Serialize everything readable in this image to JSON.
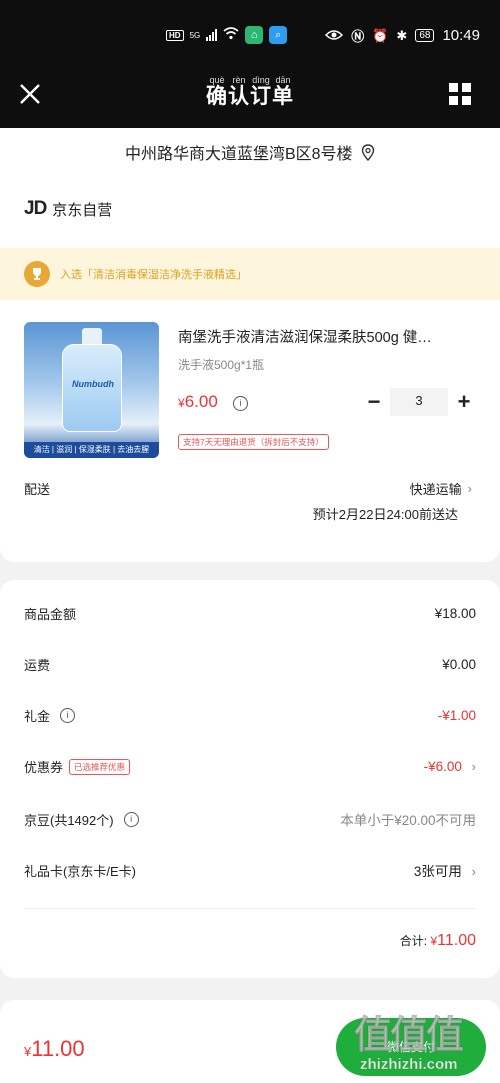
{
  "status_bar": {
    "network_label": "HD",
    "signal_label": "5G",
    "battery": "68",
    "time": "10:49"
  },
  "nav": {
    "title": "确认订单",
    "title_pinyin": [
      "què",
      "rèn",
      "dìng",
      "dān"
    ]
  },
  "address": {
    "text": "中州路华商大道蓝堡湾B区8号楼"
  },
  "shop": {
    "logo": "JD",
    "name": "京东自营"
  },
  "promo": {
    "text": "入选「清洁消毒保湿洁净洗手液精选」"
  },
  "product": {
    "title": "南堡洗手液清洁滋润保湿柔肤500g 健…",
    "spec": "洗手液500g*1瓶",
    "price_symbol": "¥",
    "price_value": "6.00",
    "quantity": "3",
    "minus": "−",
    "plus": "+",
    "return_policy": "支持7天无理由退货（拆封后不支持）",
    "image_brand": "Numbudh",
    "image_caption": "清洁 | 滋润 | 保湿柔肤 | 去油去腥"
  },
  "delivery": {
    "label": "配送",
    "method": "快递运输",
    "eta": "预计2月22日24:00前送达"
  },
  "costs": {
    "goods_label": "商品金额",
    "goods_value": "¥18.00",
    "shipping_label": "运费",
    "shipping_value": "¥0.00",
    "gift_label": "礼金",
    "gift_value": "-¥1.00",
    "coupon_label": "优惠券",
    "coupon_tag": "已选推荐优惠",
    "coupon_value": "-¥6.00",
    "beans_label": "京豆(共1492个)",
    "beans_value": "本单小于¥20.00不可用",
    "giftcard_label": "礼品卡(京东卡/E卡)",
    "giftcard_value": "3张可用",
    "total_label": "合计:",
    "total_symbol": "¥",
    "total_value": "11.00"
  },
  "bottom": {
    "price_symbol": "¥",
    "price_value": "11.00",
    "pay_label": "微信支付"
  },
  "watermark": {
    "big": "值值值",
    "small": "zhizhizhi.com"
  },
  "colors": {
    "accent_red": "#e33333",
    "pay_green": "#1fae3c",
    "promo_bg": "#fdf6dc",
    "header_bg": "#0e0e0e"
  }
}
